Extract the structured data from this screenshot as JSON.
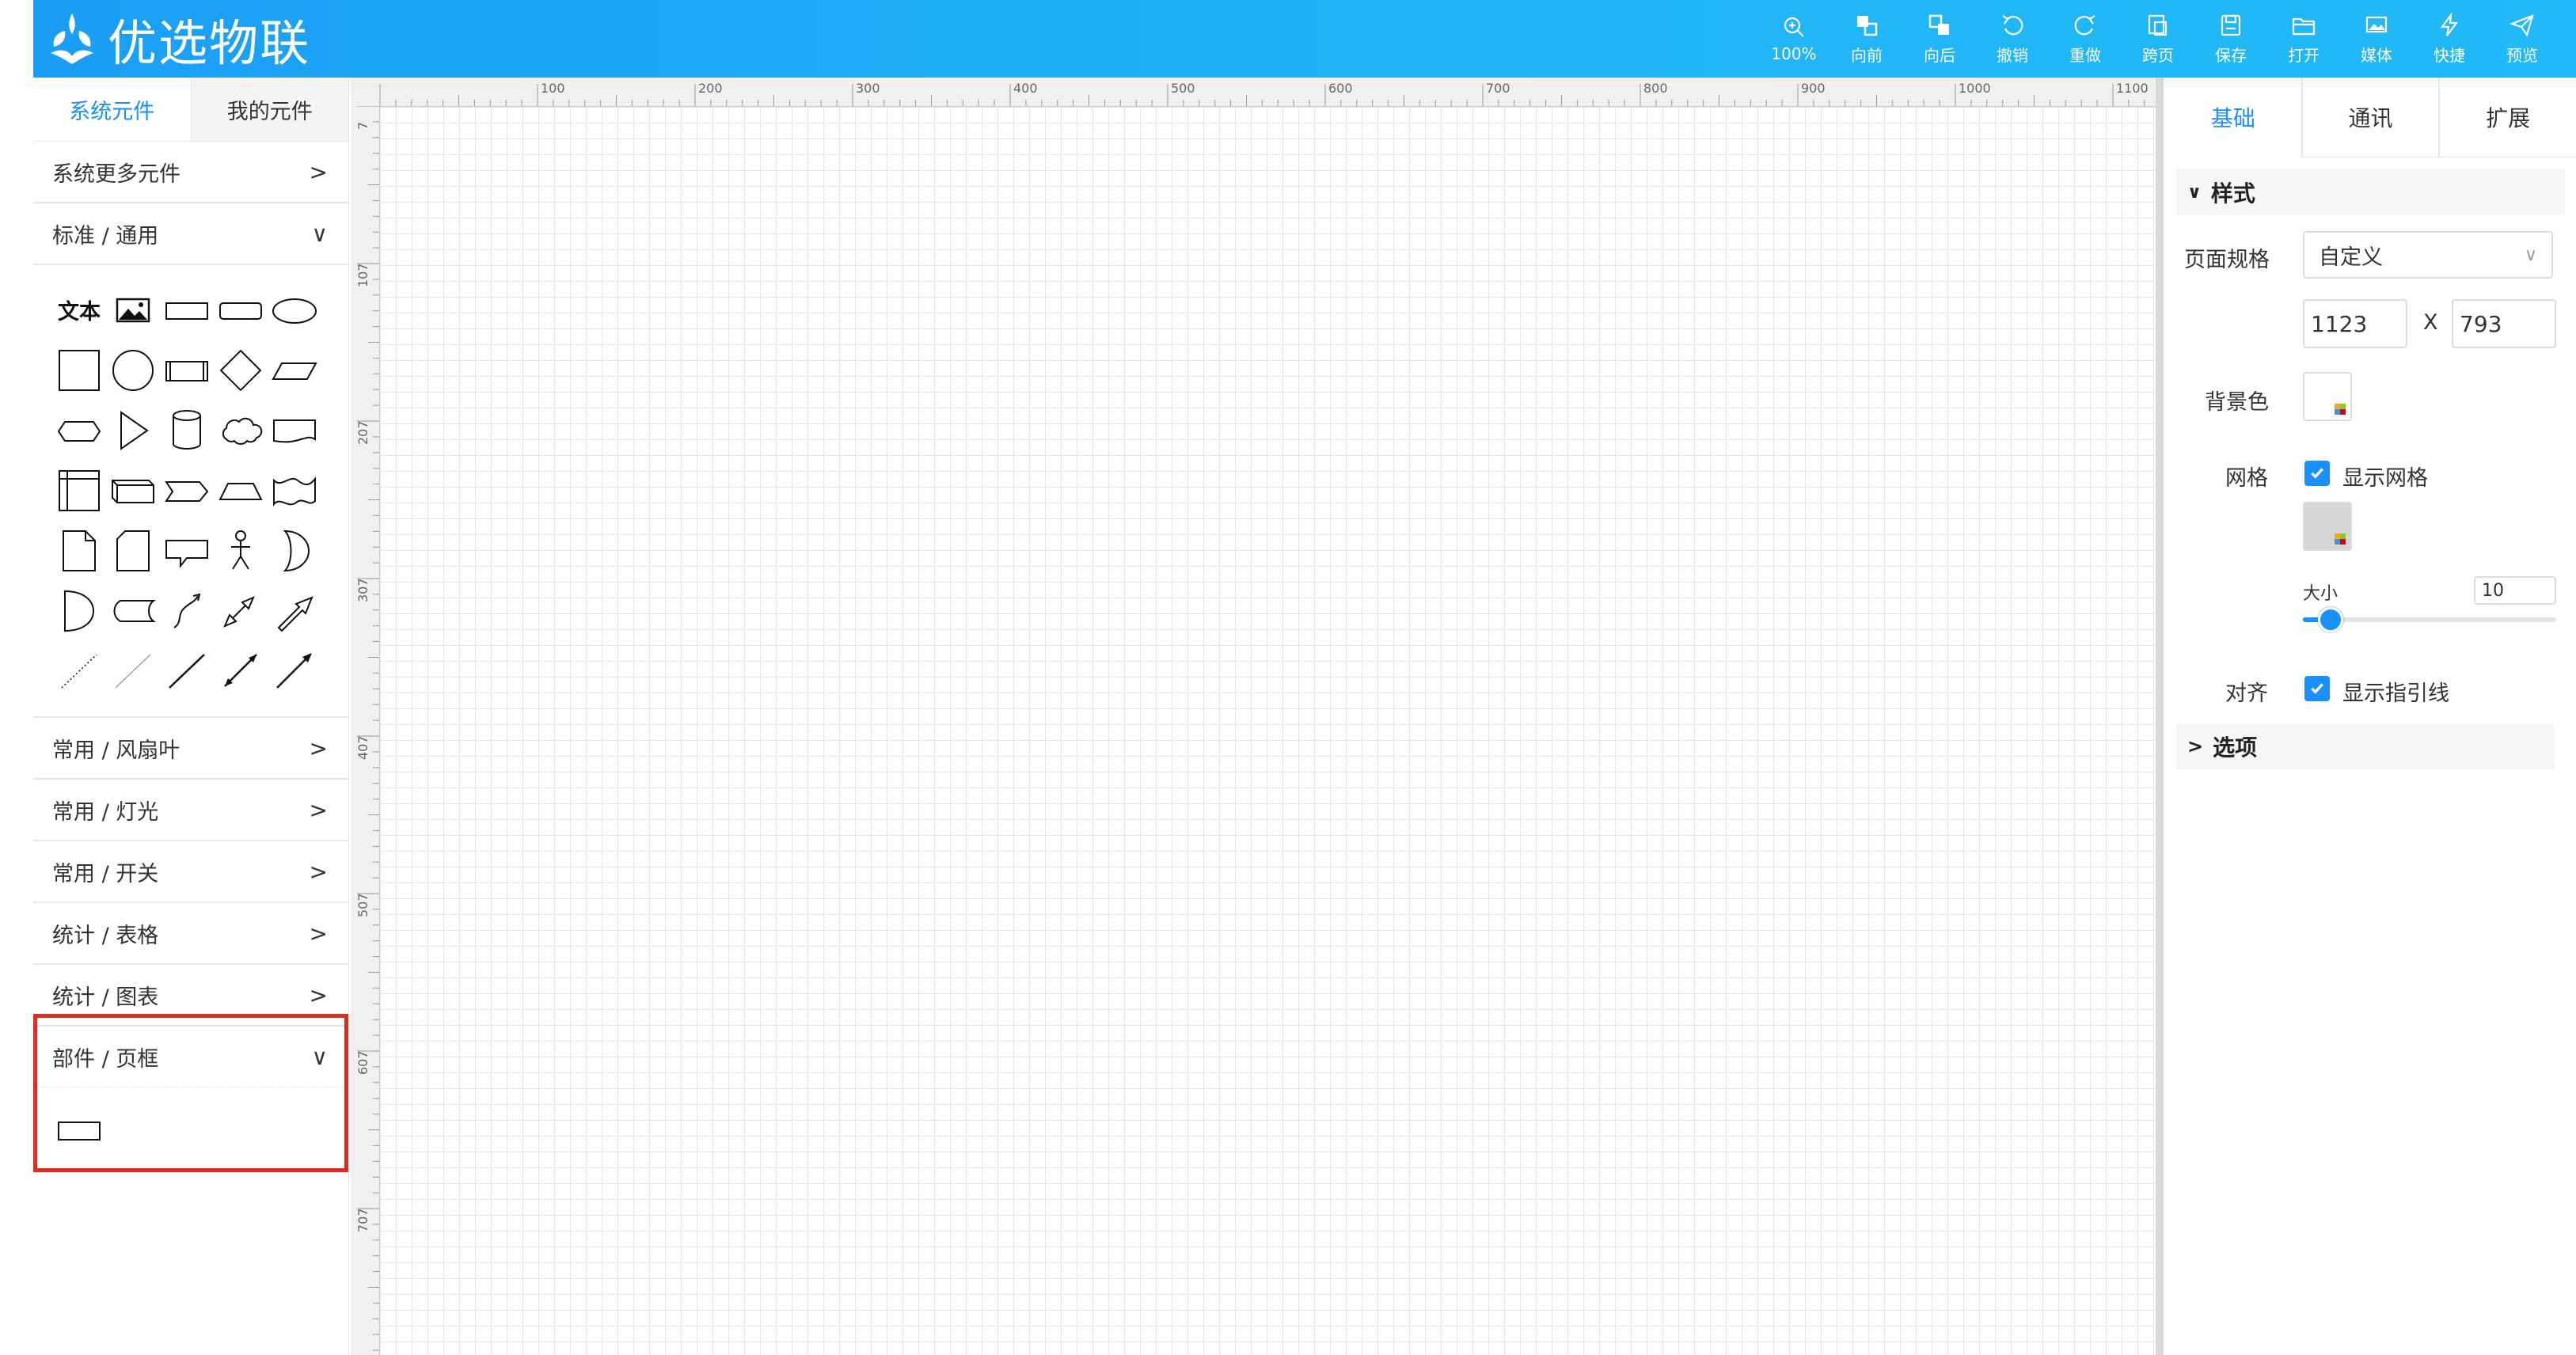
{
  "app": {
    "title": "优选物联"
  },
  "toolbar": [
    {
      "icon": "zoom-in-icon",
      "label": "100%"
    },
    {
      "icon": "bring-forward-icon",
      "label": "向前"
    },
    {
      "icon": "send-backward-icon",
      "label": "向后"
    },
    {
      "icon": "undo-icon",
      "label": "撤销"
    },
    {
      "icon": "redo-icon",
      "label": "重做"
    },
    {
      "icon": "cross-page-icon",
      "label": "跨页"
    },
    {
      "icon": "save-icon",
      "label": "保存"
    },
    {
      "icon": "folder-open-icon",
      "label": "打开"
    },
    {
      "icon": "media-icon",
      "label": "媒体"
    },
    {
      "icon": "lightning-icon",
      "label": "快捷"
    },
    {
      "icon": "send-icon",
      "label": "预览"
    }
  ],
  "left": {
    "tabs": [
      "系统元件",
      "我的元件"
    ],
    "sections": {
      "more": "系统更多元件",
      "standard": "标准 / 通用",
      "fan": "常用 / 风扇叶",
      "light": "常用 / 灯光",
      "switch": "常用 / 开关",
      "table": "统计 / 表格",
      "chart": "统计 / 图表",
      "frame": "部件 / 页框"
    },
    "text_shape": "文本",
    "arrow_right": ">",
    "arrow_down": "∨"
  },
  "ruler": {
    "top": [
      "100",
      "200",
      "300",
      "400",
      "500",
      "600",
      "700",
      "800",
      "900",
      "1000",
      "1100"
    ],
    "left": [
      "7",
      "107",
      "207",
      "307",
      "407",
      "507",
      "607",
      "707"
    ]
  },
  "right": {
    "tabs": [
      "基础",
      "通讯",
      "扩展"
    ],
    "style_group": "样式",
    "options_group": "选项",
    "page_size_label": "页面规格",
    "page_size_value": "自定义",
    "width": "1123",
    "x_sep": "X",
    "height": "793",
    "bg_label": "背景色",
    "grid_label": "网格",
    "show_grid": "显示网格",
    "size_label": "大小",
    "size_value": "10",
    "size_slider_fraction": 0.1,
    "align_label": "对齐",
    "show_guides": "显示指引线"
  },
  "colors": {
    "accent": "#1890ff",
    "header": "#1fb5f7",
    "highlight": "#e02b1f"
  }
}
